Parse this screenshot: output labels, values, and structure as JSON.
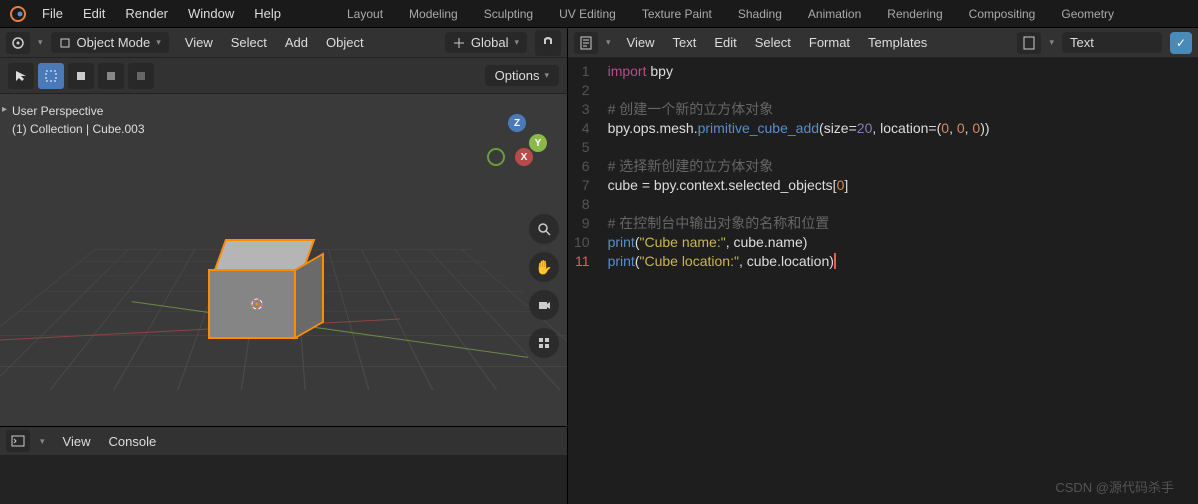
{
  "topmenu": [
    "File",
    "Edit",
    "Render",
    "Window",
    "Help"
  ],
  "workspaces": [
    "Layout",
    "Modeling",
    "Sculpting",
    "UV Editing",
    "Texture Paint",
    "Shading",
    "Animation",
    "Rendering",
    "Compositing",
    "Geometry"
  ],
  "viewport": {
    "mode": "Object Mode",
    "orientation": "Global",
    "menus": [
      "View",
      "Select",
      "Add",
      "Object"
    ],
    "overlay_line1": "User Perspective",
    "overlay_line2": "(1) Collection | Cube.003",
    "options_label": "Options",
    "gizmo": {
      "x": "X",
      "y": "Y",
      "z": "Z"
    }
  },
  "console": {
    "menus": [
      "View",
      "Console"
    ]
  },
  "texteditor": {
    "menus": [
      "View",
      "Text",
      "Edit",
      "Select",
      "Format",
      "Templates"
    ],
    "doc_label": "Text"
  },
  "code": {
    "lines": [
      {
        "n": 1,
        "t": "import",
        "parts": [
          [
            "kw",
            "import"
          ],
          [
            "sp",
            " "
          ],
          [
            "mod",
            "bpy"
          ]
        ]
      },
      {
        "n": 2,
        "t": "blank"
      },
      {
        "n": 3,
        "t": "comment",
        "text": "# 创建一个新的立方体对象"
      },
      {
        "n": 4,
        "t": "call",
        "parts": [
          [
            "mod",
            "bpy"
          ],
          [
            "p",
            "."
          ],
          [
            "mod",
            "ops"
          ],
          [
            "p",
            "."
          ],
          [
            "mod",
            "mesh"
          ],
          [
            "p",
            "."
          ],
          [
            "fn",
            "primitive_cube_add"
          ],
          [
            "p",
            "("
          ],
          [
            "mod",
            "size"
          ],
          [
            "p",
            "="
          ],
          [
            "num",
            "20"
          ],
          [
            "p",
            ", "
          ],
          [
            "mod",
            "location"
          ],
          [
            "p",
            "="
          ],
          [
            "p",
            "("
          ],
          [
            "lit",
            "0"
          ],
          [
            "p",
            ", "
          ],
          [
            "lit",
            "0"
          ],
          [
            "p",
            ", "
          ],
          [
            "lit",
            "0"
          ],
          [
            "p",
            "))"
          ]
        ]
      },
      {
        "n": 5,
        "t": "blank"
      },
      {
        "n": 6,
        "t": "comment",
        "text": "# 选择新创建的立方体对象"
      },
      {
        "n": 7,
        "t": "assign",
        "parts": [
          [
            "mod",
            "cube "
          ],
          [
            "p",
            "= "
          ],
          [
            "mod",
            "bpy"
          ],
          [
            "p",
            "."
          ],
          [
            "mod",
            "context"
          ],
          [
            "p",
            "."
          ],
          [
            "mod",
            "selected_objects"
          ],
          [
            "p",
            "["
          ],
          [
            "lit",
            "0"
          ],
          [
            "p",
            "]"
          ]
        ]
      },
      {
        "n": 8,
        "t": "blank"
      },
      {
        "n": 9,
        "t": "comment",
        "text": "# 在控制台中输出对象的名称和位置"
      },
      {
        "n": 10,
        "t": "call",
        "parts": [
          [
            "fn",
            "print"
          ],
          [
            "p",
            "("
          ],
          [
            "str",
            "\"Cube name:\""
          ],
          [
            "p",
            ", "
          ],
          [
            "mod",
            "cube"
          ],
          [
            "p",
            "."
          ],
          [
            "mod",
            "name"
          ],
          [
            "p",
            ")"
          ]
        ]
      },
      {
        "n": 11,
        "t": "call",
        "parts": [
          [
            "fn",
            "print"
          ],
          [
            "p",
            "("
          ],
          [
            "str",
            "\"Cube location:\""
          ],
          [
            "p",
            ", "
          ],
          [
            "mod",
            "cube"
          ],
          [
            "p",
            "."
          ],
          [
            "mod",
            "location"
          ],
          [
            "p",
            ")"
          ]
        ]
      }
    ]
  },
  "watermark": "CSDN @源代码杀手"
}
